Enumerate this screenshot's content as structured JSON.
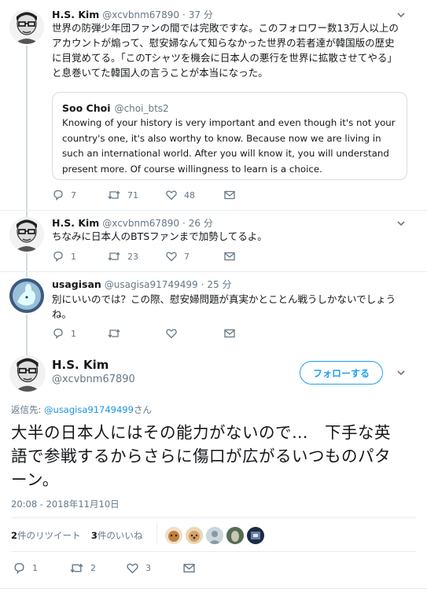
{
  "tweet1": {
    "name": "H.S. Kim",
    "handle": "@xcvbnm67890",
    "sep": "·",
    "time": "37 分",
    "text": "世界の防弾少年団ファンの間では完敗ですな。このフォロワー数13万人以上のアカウントが煽って、慰安婦なんて知らなかった世界の若者達が韓国版の歴史に目覚めてる。「このTシャツを機会に日本人の悪行を世界に拡散させてやる」と息巻いてた韓国人の言うことが本当になった。",
    "quote": {
      "name": "Soo Choi",
      "handle": "@choi_bts2",
      "text": "Knowing of your history is very important and even though it's not your country's one, it's also worthy to know. Because now we are living in such an international world. After you will know it, you will understand present more. Of course willingness to learn is a choice."
    },
    "replies": "7",
    "retweets": "71",
    "likes": "48"
  },
  "tweet2": {
    "name": "H.S. Kim",
    "handle": "@xcvbnm67890",
    "sep": "·",
    "time": "26 分",
    "text": "ちなみに日本人のBTSファンまで加勢してるよ。",
    "replies": "1",
    "retweets": "23",
    "likes": "7"
  },
  "tweet3": {
    "name": "usagisan",
    "handle": "@usagisa91749499",
    "sep": "·",
    "time": "25 分",
    "text": "別にいいのでは？この際、慰安婦問題が真実かとことん戦うしかないでしょうね。",
    "replies": "1",
    "retweets": "",
    "likes": ""
  },
  "main": {
    "name": "H.S. Kim",
    "handle": "@xcvbnm67890",
    "follow_label": "フォローする",
    "reply_to_prefix": "返信先: ",
    "reply_to_handle": "@usagisa91749499",
    "reply_to_suffix": "さん",
    "text": "大半の日本人にはその能力がないので…　下手な英語で参戦するからさらに傷口が広がるいつものパターン。",
    "timestamp": "20:08 - 2018年11月10日",
    "retweet_count": "2",
    "retweet_label": "件のリツイート",
    "like_count": "3",
    "like_label": "件のいいね",
    "replies": "1",
    "retweets": "2",
    "likes": "3"
  },
  "colors": {
    "accent": "#1da1f2",
    "muted": "#657786",
    "thread_line": "#cfdbe3"
  }
}
